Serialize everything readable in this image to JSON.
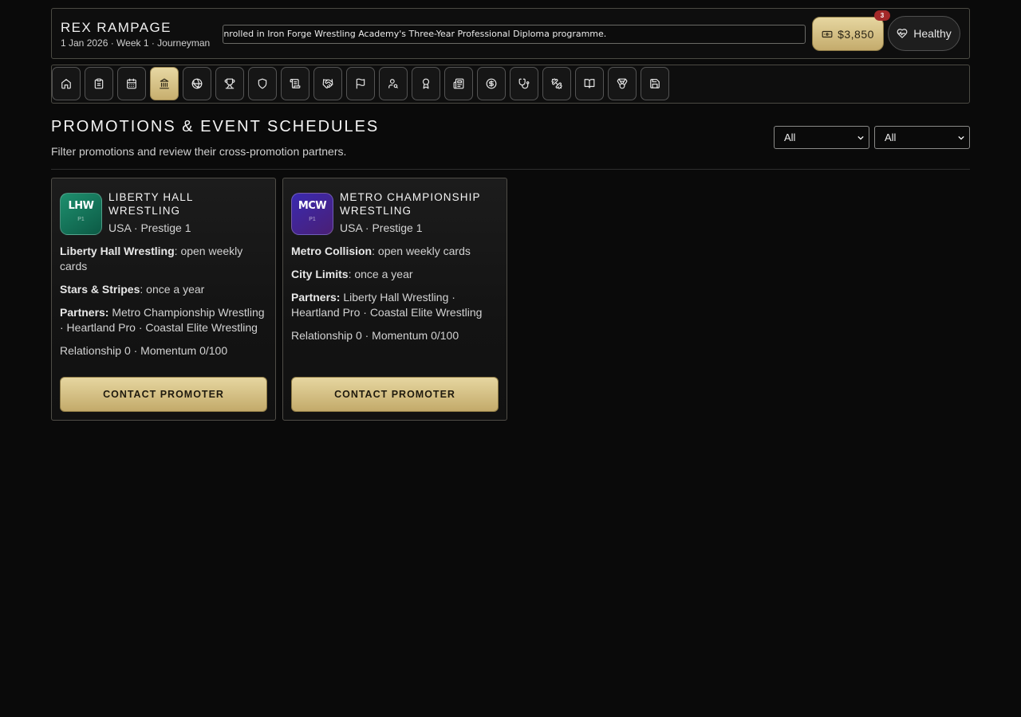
{
  "header": {
    "player_name": "REX RAMPAGE",
    "subtitle": "1 Jan 2026 · Week 1 · Journeyman",
    "ticker": "Rex Rampage enrolled in Iron Forge Wrestling Academy's Three-Year Professional Diploma programme.",
    "money": "$3,850",
    "notification_count": "3",
    "health": "Healthy"
  },
  "nav": {
    "items": [
      {
        "icon": "home-icon"
      },
      {
        "icon": "clipboard-icon"
      },
      {
        "icon": "calendar-icon"
      },
      {
        "icon": "landmark-icon",
        "active": true
      },
      {
        "icon": "ball-icon"
      },
      {
        "icon": "trophy-icon"
      },
      {
        "icon": "shield-icon"
      },
      {
        "icon": "scroll-icon"
      },
      {
        "icon": "handshake-icon"
      },
      {
        "icon": "flag-icon"
      },
      {
        "icon": "user-search-icon"
      },
      {
        "icon": "award-icon"
      },
      {
        "icon": "newspaper-icon"
      },
      {
        "icon": "dollar-icon"
      },
      {
        "icon": "stethoscope-icon"
      },
      {
        "icon": "dumbbell-icon"
      },
      {
        "icon": "book-icon"
      },
      {
        "icon": "medal-icon"
      },
      {
        "icon": "save-icon"
      }
    ]
  },
  "page": {
    "title": "PROMOTIONS & EVENT SCHEDULES",
    "subtitle": "Filter promotions and review their cross-promotion partners.",
    "filter_1": "All",
    "filter_2": "All"
  },
  "promotions": [
    {
      "abbr": "LHW",
      "tier": "P1",
      "name": "LIBERTY HALL WRESTLING",
      "meta": "USA · Prestige 1",
      "weekly_show": "Liberty Hall Wrestling",
      "weekly_desc": ": open weekly cards",
      "ppv_show": "Stars & Stripes",
      "ppv_desc": ": once a year",
      "partners_label": "Partners:",
      "partners": " Metro Championship Wrestling · Heartland Pro · Coastal Elite Wrestling",
      "stats": "Relationship 0 · Momentum 0/100",
      "button": "CONTACT PROMOTER",
      "color": "#1e8f6e"
    },
    {
      "abbr": "MCW",
      "tier": "P1",
      "name": "METRO CHAMPIONSHIP WRESTLING",
      "meta": "USA · Prestige 1",
      "weekly_show": "Metro Collision",
      "weekly_desc": ": open weekly cards",
      "ppv_show": "City Limits",
      "ppv_desc": ": once a year",
      "partners_label": "Partners:",
      "partners": " Liberty Hall Wrestling · Heartland Pro · Coastal Elite Wrestling",
      "stats": "Relationship 0 · Momentum 0/100",
      "button": "CONTACT PROMOTER",
      "color": "#3a2a9e"
    }
  ],
  "colors": {
    "accent_gold": "#d8c285",
    "background": "#0a0a0a",
    "badge_red": "#a32929"
  }
}
